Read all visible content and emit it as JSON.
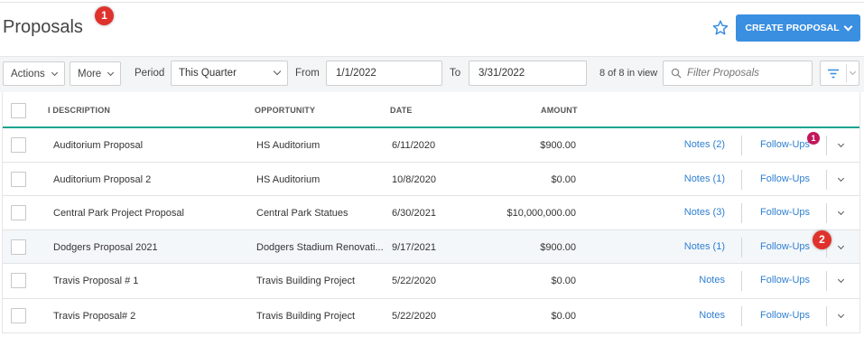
{
  "page": {
    "title": "Proposals"
  },
  "annotations": {
    "step1": "1",
    "step2": "2"
  },
  "header": {
    "create_label": "CREATE PROPOSAL"
  },
  "toolbar": {
    "actions_label": "Actions",
    "more_label": "More",
    "period_label": "Period",
    "period_value": "This Quarter",
    "from_label": "From",
    "from_value": "1/1/2022",
    "to_label": "To",
    "to_value": "3/31/2022",
    "count_text": "8 of 8 in view",
    "filter_placeholder": "Filter Proposals"
  },
  "table": {
    "columns": {
      "description": "I DESCRIPTION",
      "opportunity": "OPPORTUNITY",
      "date": "DATE",
      "amount": "AMOUNT"
    },
    "rows": [
      {
        "description": "Auditorium Proposal",
        "opportunity": "HS Auditorium",
        "date": "6/11/2020",
        "amount": "$900.00",
        "notes": "Notes (2)",
        "followups": "Follow-Ups",
        "followup_badge": "1"
      },
      {
        "description": "Auditorium Proposal 2",
        "opportunity": "HS Auditorium",
        "date": "10/8/2020",
        "amount": "$0.00",
        "notes": "Notes (1)",
        "followups": "Follow-Ups"
      },
      {
        "description": "Central Park Project Proposal",
        "opportunity": "Central Park Statues",
        "date": "6/30/2021",
        "amount": "$10,000,000.00",
        "notes": "Notes (3)",
        "followups": "Follow-Ups"
      },
      {
        "description": "Dodgers Proposal 2021",
        "opportunity": "Dodgers Stadium Renovati...",
        "date": "9/17/2021",
        "amount": "$900.00",
        "notes": "Notes (1)",
        "followups": "Follow-Ups"
      },
      {
        "description": "Travis Proposal # 1",
        "opportunity": "Travis Building Project",
        "date": "5/22/2020",
        "amount": "$0.00",
        "notes": "Notes",
        "followups": "Follow-Ups"
      },
      {
        "description": "Travis Proposal# 2",
        "opportunity": "Travis Building Project",
        "date": "5/22/2020",
        "amount": "$0.00",
        "notes": "Notes",
        "followups": "Follow-Ups"
      }
    ]
  },
  "colors": {
    "accent": "#3a8fe0",
    "link": "#2f7fd0",
    "header_rule": "#1aa38c",
    "badge_red": "#e0322d",
    "badge_pink": "#c2185b"
  },
  "icons": {
    "favorite": "star-icon",
    "search": "search-icon",
    "filter": "filter-icon"
  }
}
